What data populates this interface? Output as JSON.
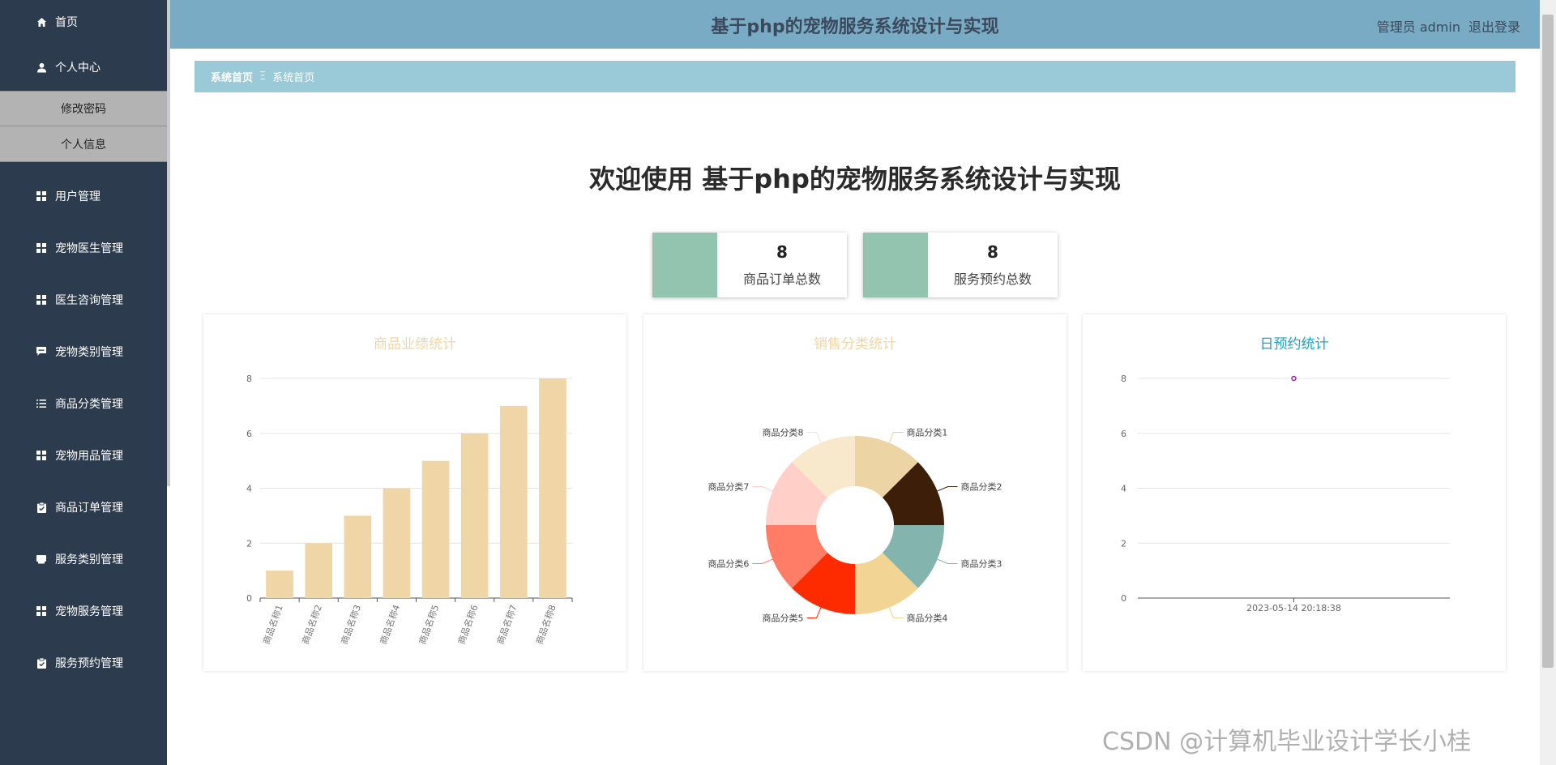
{
  "app": {
    "title": "基于php的宠物服务系统设计与实现",
    "user_label": "管理员 admin",
    "logout_label": "退出登录"
  },
  "sidebar": {
    "home": "首页",
    "personal_center": "个人中心",
    "sub_items": [
      "修改密码",
      "个人信息"
    ],
    "items": [
      {
        "label": "用户管理",
        "icon": "grid-icon"
      },
      {
        "label": "宠物医生管理",
        "icon": "grid-icon"
      },
      {
        "label": "医生咨询管理",
        "icon": "grid-icon"
      },
      {
        "label": "宠物类别管理",
        "icon": "chat-icon"
      },
      {
        "label": "商品分类管理",
        "icon": "list-icon"
      },
      {
        "label": "宠物用品管理",
        "icon": "grid-icon"
      },
      {
        "label": "商品订单管理",
        "icon": "clipboard-icon"
      },
      {
        "label": "服务类别管理",
        "icon": "card-icon"
      },
      {
        "label": "宠物服务管理",
        "icon": "grid-icon"
      },
      {
        "label": "服务预约管理",
        "icon": "clipboard-icon"
      }
    ]
  },
  "breadcrumb": {
    "home": "系统首页",
    "separator": "Ξ",
    "current": "系统首页"
  },
  "welcome": "欢迎使用 基于php的宠物服务系统设计与实现",
  "stats": [
    {
      "value": "8",
      "label": "商品订单总数"
    },
    {
      "value": "8",
      "label": "服务预约总数"
    }
  ],
  "colors": {
    "sidebar_bg": "#2c3b4e",
    "header_bg": "#79abc4",
    "breadcrumb_bg": "#9ac9d7",
    "stat_block": "#93c4b0",
    "bar_fill": "#f0d6a7",
    "line_title": "#1ca2c4",
    "line_point": "#a020a0"
  },
  "chart_data": [
    {
      "type": "bar",
      "title": "商品业绩统计",
      "categories": [
        "商品名称1",
        "商品名称2",
        "商品名称3",
        "商品名称4",
        "商品名称5",
        "商品名称6",
        "商品名称7",
        "商品名称8"
      ],
      "values": [
        1,
        2,
        3,
        4,
        5,
        6,
        7,
        8
      ],
      "ylim": [
        0,
        8
      ],
      "yticks": [
        0,
        2,
        4,
        6,
        8
      ],
      "grid": true
    },
    {
      "type": "pie",
      "title": "销售分类统计",
      "donut": true,
      "labels": [
        "商品分类1",
        "商品分类2",
        "商品分类3",
        "商品分类4",
        "商品分类5",
        "商品分类6",
        "商品分类7",
        "商品分类8"
      ],
      "values": [
        1,
        1,
        1,
        1,
        1,
        1,
        1,
        1
      ],
      "colors": [
        "#edd4a5",
        "#3d1f09",
        "#83b5ae",
        "#f2d594",
        "#ff2b00",
        "#ff7c66",
        "#ffcfc8",
        "#f8e8cc"
      ]
    },
    {
      "type": "line",
      "title": "日预约统计",
      "x": [
        "2023-05-14 20:18:38"
      ],
      "values": [
        8
      ],
      "ylim": [
        0,
        8
      ],
      "yticks": [
        0,
        2,
        4,
        6,
        8
      ],
      "grid": true
    }
  ],
  "watermark": "CSDN @计算机毕业设计学长小桂"
}
